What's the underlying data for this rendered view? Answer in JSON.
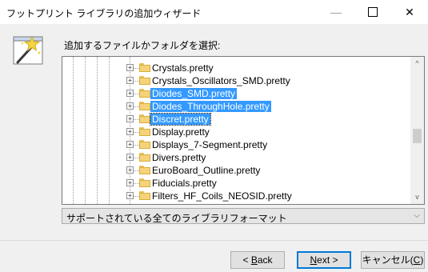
{
  "window": {
    "title": "フットプリント ライブラリの追加ウィザード",
    "minimize_icon": "—",
    "close_icon": "✕"
  },
  "prompt": "追加するファイルかフォルダを選択:",
  "tree": {
    "items": [
      {
        "label": "Crystals.pretty",
        "selected": false,
        "focused": false
      },
      {
        "label": "Crystals_Oscillators_SMD.pretty",
        "selected": false,
        "focused": false
      },
      {
        "label": "Diodes_SMD.pretty",
        "selected": true,
        "focused": false
      },
      {
        "label": "Diodes_ThroughHole.pretty",
        "selected": true,
        "focused": false
      },
      {
        "label": "Discret.pretty",
        "selected": true,
        "focused": true
      },
      {
        "label": "Display.pretty",
        "selected": false,
        "focused": false
      },
      {
        "label": "Displays_7-Segment.pretty",
        "selected": false,
        "focused": false
      },
      {
        "label": "Divers.pretty",
        "selected": false,
        "focused": false
      },
      {
        "label": "EuroBoard_Outline.pretty",
        "selected": false,
        "focused": false
      },
      {
        "label": "Fiducials.pretty",
        "selected": false,
        "focused": false
      },
      {
        "label": "Filters_HF_Coils_NEOSID.pretty",
        "selected": false,
        "focused": false
      }
    ],
    "expander_symbol": "+",
    "selection_color": "#3399ff",
    "folder_color": "#f5d37a",
    "scrollbar": {
      "up_arrow": "^",
      "down_arrow": "v"
    }
  },
  "filter": {
    "value": "サポートされている全てのライブラリフォーマット",
    "chevron": "⌵"
  },
  "buttons": {
    "back": {
      "prefix": "< ",
      "mnemonic": "B",
      "rest": "ack"
    },
    "next": {
      "prefix": "",
      "mnemonic": "N",
      "rest": "ext >"
    },
    "cancel": {
      "prefix": "キャンセル(",
      "mnemonic": "C",
      "rest": ")"
    }
  },
  "colors": {
    "accent": "#0078d7"
  }
}
